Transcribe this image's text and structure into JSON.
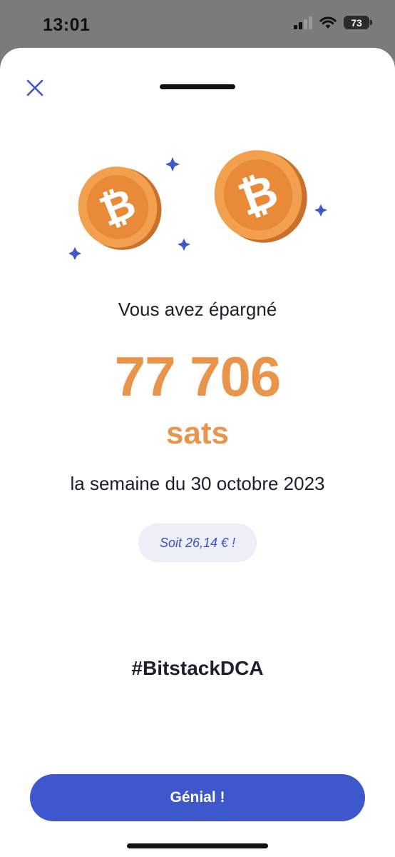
{
  "status_bar": {
    "time": "13:01",
    "battery": "73",
    "icons": [
      "cellular-signal-icon",
      "wifi-icon",
      "battery-icon"
    ]
  },
  "sheet": {
    "close_icon": "close-icon",
    "illustration_icons": [
      "bitcoin-coin-icon",
      "bitcoin-coin-icon",
      "sparkle-icon"
    ],
    "headline": "Vous avez épargné",
    "amount": "77 706",
    "unit": "sats",
    "period": "la semaine du 30 octobre 2023",
    "fiat_equivalent": "Soit 26,14 € !",
    "hashtag": "#BitstackDCA",
    "cta_label": "Génial !"
  },
  "colors": {
    "accent_blue": "#3e57cc",
    "bitcoin_orange": "#e8944a",
    "pill_background": "#eceef8",
    "text_dark": "#1c1f2e"
  }
}
